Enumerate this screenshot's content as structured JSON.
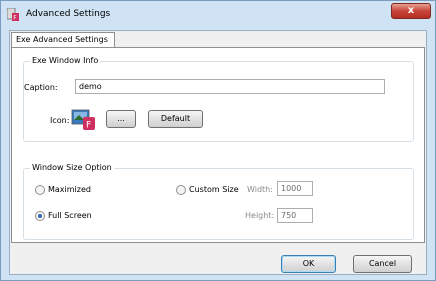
{
  "window": {
    "title": "Advanced Settings",
    "close_label": "x"
  },
  "tab": {
    "label": "Exe Advanced Settings"
  },
  "exe_info": {
    "group_title": "Exe Window Info",
    "caption_label": "Caption:",
    "caption_value": "demo",
    "icon_label": "Icon:",
    "browse_label": "...",
    "default_label": "Default"
  },
  "size_option": {
    "group_title": "Window Size Option",
    "maximized_label": "Maximized",
    "full_screen_label": "Full Screen",
    "custom_size_label": "Custom Size",
    "width_label": "Width:",
    "width_value": "1000",
    "height_label": "Height:",
    "height_value": "750",
    "selected": "full_screen"
  },
  "footer": {
    "ok_label": "OK",
    "cancel_label": "Cancel"
  }
}
